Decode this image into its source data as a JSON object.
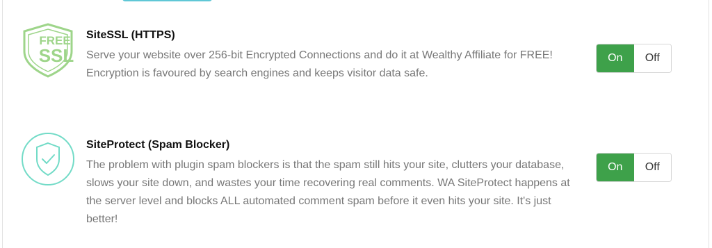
{
  "features": [
    {
      "icon": "ssl-shield-icon",
      "icon_line1": "FREE",
      "icon_line2": "SSL",
      "title": "SiteSSL (HTTPS)",
      "description": "Serve your website over 256-bit Encrypted Connections and do it at Wealthy Affiliate for FREE! Encryption is favoured by search engines and keeps visitor data safe.",
      "toggle": {
        "on_label": "On",
        "off_label": "Off",
        "selected": "On"
      }
    },
    {
      "icon": "shield-check-icon",
      "title": "SiteProtect (Spam Blocker)",
      "description": "The problem with plugin spam blockers is that the spam still hits your site, clutters your database, slows your site down, and wastes your time recovering real comments. WA SiteProtect happens at the server level and blocks ALL automated comment spam before it even hits your site. It's just better!",
      "toggle": {
        "on_label": "On",
        "off_label": "Off",
        "selected": "On"
      }
    }
  ],
  "colors": {
    "toggle_on": "#3ea14a",
    "ssl_icon": "#9ed58a",
    "protect_icon": "#72dbc7",
    "description_text": "#777777"
  }
}
